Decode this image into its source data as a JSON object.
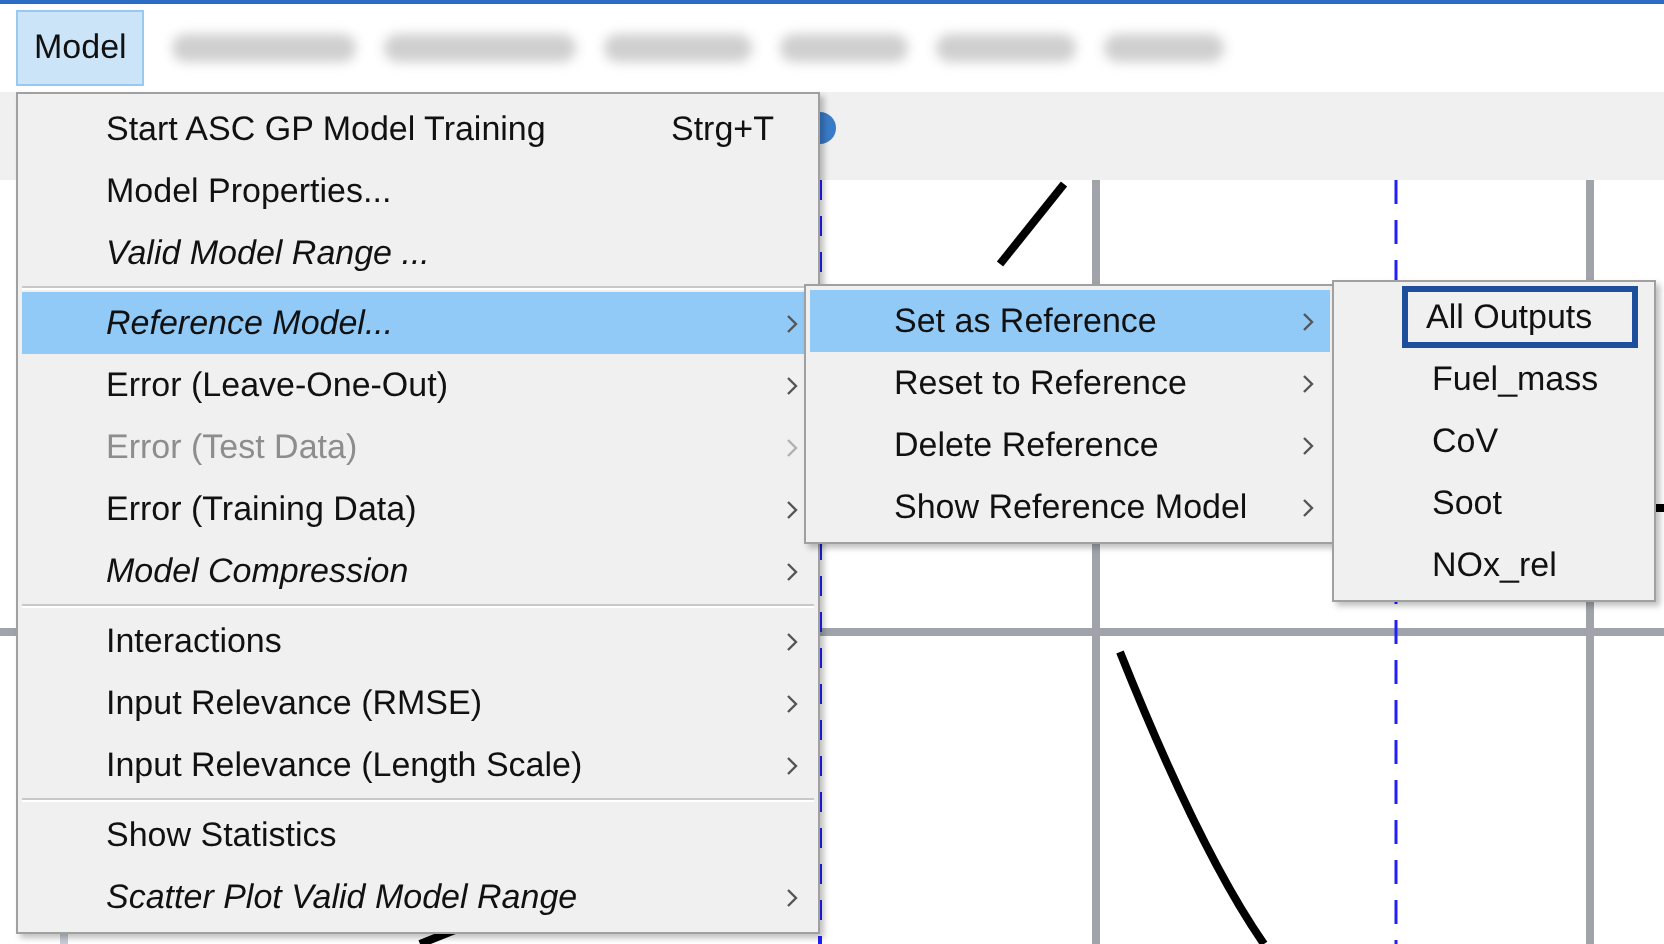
{
  "menu_bar": {
    "items": [
      {
        "label": "Model",
        "selected": true
      }
    ]
  },
  "model_menu": {
    "items": [
      {
        "kind": "item",
        "label": "Start ASC GP Model Training",
        "shortcut": "Strg+T",
        "italic": false,
        "disabled": false,
        "has_submenu": false,
        "selected": false
      },
      {
        "kind": "item",
        "label": "Model Properties...",
        "italic": false,
        "disabled": false,
        "has_submenu": false,
        "selected": false
      },
      {
        "kind": "item",
        "label": "Valid Model Range ...",
        "italic": true,
        "disabled": false,
        "has_submenu": false,
        "selected": false
      },
      {
        "kind": "separator"
      },
      {
        "kind": "item",
        "label": "Reference Model...",
        "italic": true,
        "disabled": false,
        "has_submenu": true,
        "selected": true
      },
      {
        "kind": "item",
        "label": "Error (Leave-One-Out)",
        "italic": false,
        "disabled": false,
        "has_submenu": true,
        "selected": false
      },
      {
        "kind": "item",
        "label": "Error (Test Data)",
        "italic": false,
        "disabled": true,
        "has_submenu": true,
        "selected": false
      },
      {
        "kind": "item",
        "label": "Error (Training Data)",
        "italic": false,
        "disabled": false,
        "has_submenu": true,
        "selected": false
      },
      {
        "kind": "item",
        "label": "Model Compression",
        "italic": true,
        "disabled": false,
        "has_submenu": true,
        "selected": false
      },
      {
        "kind": "separator"
      },
      {
        "kind": "item",
        "label": "Interactions",
        "italic": false,
        "disabled": false,
        "has_submenu": true,
        "selected": false
      },
      {
        "kind": "item",
        "label": "Input Relevance (RMSE)",
        "italic": false,
        "disabled": false,
        "has_submenu": true,
        "selected": false
      },
      {
        "kind": "item",
        "label": "Input Relevance (Length Scale)",
        "italic": false,
        "disabled": false,
        "has_submenu": true,
        "selected": false
      },
      {
        "kind": "separator"
      },
      {
        "kind": "item",
        "label": "Show Statistics",
        "italic": false,
        "disabled": false,
        "has_submenu": false,
        "selected": false
      },
      {
        "kind": "item",
        "label": "Scatter Plot Valid Model Range",
        "italic": true,
        "disabled": false,
        "has_submenu": true,
        "selected": false
      }
    ]
  },
  "reference_submenu": {
    "items": [
      {
        "label": "Set as Reference",
        "has_submenu": true,
        "selected": true
      },
      {
        "label": "Reset to Reference",
        "has_submenu": true,
        "selected": false
      },
      {
        "label": "Delete Reference",
        "has_submenu": true,
        "selected": false
      },
      {
        "label": "Show Reference Model",
        "has_submenu": true,
        "selected": false
      }
    ]
  },
  "outputs_submenu": {
    "items": [
      {
        "label": "All Outputs",
        "selected": true
      },
      {
        "label": "Fuel_mass",
        "selected": false
      },
      {
        "label": "CoV",
        "selected": false
      },
      {
        "label": "Soot",
        "selected": false
      },
      {
        "label": "NOx_rel",
        "selected": false
      }
    ]
  }
}
